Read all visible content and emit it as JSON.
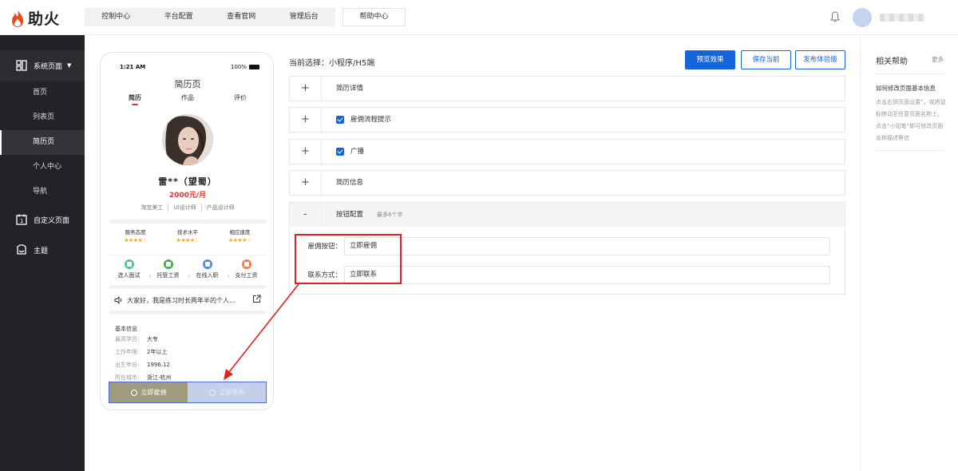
{
  "brand": {
    "name": "助火",
    "flame_color": "#e84a1e"
  },
  "topnav": {
    "items": [
      "控制中心",
      "平台配置",
      "查看官网",
      "管理后台"
    ],
    "help": "帮助中心"
  },
  "sidebar": {
    "groups": [
      {
        "label": "系统页面",
        "icon": "layout-icon",
        "items": [
          "首页",
          "列表页",
          "简历页",
          "个人中心",
          "导航"
        ],
        "active_item": "简历页"
      },
      {
        "label": "自定义页面",
        "icon": "calendar-icon"
      },
      {
        "label": "主题",
        "icon": "theme-icon"
      }
    ]
  },
  "phone": {
    "time": "1:21 AM",
    "battery": "100%",
    "page_title": "简历页",
    "tabs": [
      "简历",
      "作品",
      "评价"
    ],
    "name": "雷**（望蜀）",
    "salary": "2000元/月",
    "tags": [
      "淘宝美工",
      "UI设计师",
      "产品设计师"
    ],
    "ratings": [
      {
        "label": "服务态度",
        "stars": "★★★★☆"
      },
      {
        "label": "技术水平",
        "stars": "★★★★☆"
      },
      {
        "label": "相应速度",
        "stars": "★★★★☆"
      }
    ],
    "steps": [
      {
        "label": "选人面试",
        "color": "#4fc3a1"
      },
      {
        "label": "托管工资",
        "color": "#4caf50"
      },
      {
        "label": "在线入职",
        "color": "#4a8fe2"
      },
      {
        "label": "支付工资",
        "color": "#f57c4a"
      }
    ],
    "broadcast": "大家好，我是练习时长两年半的个人...",
    "basic_title": "基本信息",
    "basic_info": [
      {
        "k": "最高学历:",
        "v": "大专"
      },
      {
        "k": "工作年限:",
        "v": "2年以上"
      },
      {
        "k": "出生年份:",
        "v": "1996.12"
      },
      {
        "k": "所在城市:",
        "v": "浙江-杭州"
      }
    ],
    "btn_hire": "立即雇佣",
    "btn_contact": "立即联系"
  },
  "config": {
    "current_selection": "当前选择：小程序/H5端",
    "btn_preview": "预览效果",
    "btn_save": "保存当前",
    "btn_publish": "发布体验版",
    "panels": [
      {
        "sign": "+",
        "label": "简历详情",
        "checked": false
      },
      {
        "sign": "+",
        "label": "雇佣流程提示",
        "checked": true
      },
      {
        "sign": "+",
        "label": "广播",
        "checked": true
      },
      {
        "sign": "+",
        "label": "简历信息",
        "checked": false
      }
    ],
    "open_panel": {
      "sign": "-",
      "label": "按钮配置",
      "hint": "最多6个字"
    },
    "fields": [
      {
        "label": "雇佣按钮：",
        "value": "立即雇佣"
      },
      {
        "label": "联系方式：",
        "value": "立即联系"
      }
    ]
  },
  "help": {
    "title": "相关帮助",
    "more": "更多",
    "question": "如何修改页面基本信息",
    "answer": "点击右侧页面设置”，或将鼠标移动至任意页面名称上，点击“小铅笔”即可修改页面名称描述等信"
  }
}
